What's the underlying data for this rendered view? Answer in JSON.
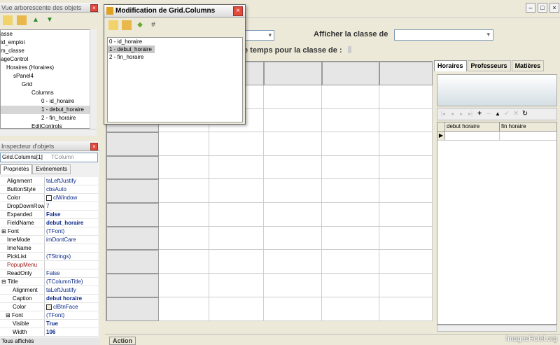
{
  "tree_panel": {
    "title": "Vue arborescente des objets",
    "items": [
      "asse",
      "id_emploi",
      "m_classe",
      "ageControl",
      "Horaires (Horaires)",
      "sPanel4",
      "Grid",
      "Columns",
      "0 - id_horaire",
      "1 - debut_horaire",
      "2 - fin_horaire",
      "EditControls"
    ]
  },
  "inspector": {
    "title": "Inspecteur d'objets",
    "selected": "Grid.Columns[1]",
    "selected_type": "TColumn",
    "tabs": [
      "Propriétés",
      "Evénements"
    ],
    "rows": [
      {
        "k": "Alignment",
        "v": "taLeftJustify"
      },
      {
        "k": "ButtonStyle",
        "v": "cbsAuto"
      },
      {
        "k": "Color",
        "v": "clWindow"
      },
      {
        "k": "DropDownRow",
        "v": "7"
      },
      {
        "k": "Expanded",
        "v": "False"
      },
      {
        "k": "FieldName",
        "v": "debut_horaire"
      },
      {
        "k": "Font",
        "v": "(TFont)"
      },
      {
        "k": "ImeMode",
        "v": "imDontCare"
      },
      {
        "k": "ImeName",
        "v": ""
      },
      {
        "k": "PickList",
        "v": "(TStrings)"
      },
      {
        "k": "PopupMenu",
        "v": ""
      },
      {
        "k": "ReadOnly",
        "v": "False"
      },
      {
        "k": "Title",
        "v": "(TColumnTitle)"
      },
      {
        "k": "Alignment",
        "v": "taLeftJustify"
      },
      {
        "k": "Caption",
        "v": "debut horaire"
      },
      {
        "k": "Color",
        "v": "clBtnFace"
      },
      {
        "k": "Font",
        "v": "(TFont)"
      },
      {
        "k": "Visible",
        "v": "True"
      },
      {
        "k": "Width",
        "v": "106"
      }
    ],
    "status": "Tous affichés"
  },
  "dialog": {
    "title": "Modification de Grid.Columns",
    "items": [
      "0 - id_horaire",
      "1 - debut_horaire",
      "2 - fin_horaire"
    ]
  },
  "main": {
    "afficher_label": "Afficher la classe de",
    "temps_label": "e temps pour la classe de :",
    "action_label": "Action"
  },
  "right_tabs": [
    "Horaires",
    "Professeurs",
    "Matières"
  ],
  "right_grid": {
    "columns": [
      "debut horaire",
      "fin horaire"
    ]
  },
  "watermark": "ImagesHotel.org"
}
